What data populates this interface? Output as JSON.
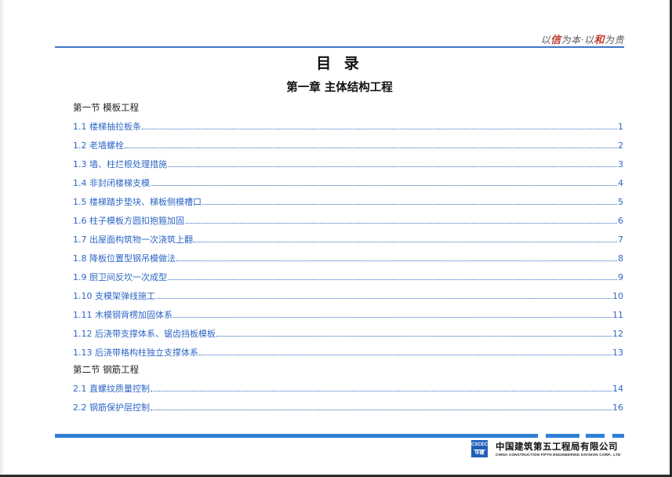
{
  "header": {
    "slogan_a": "以",
    "slogan_b": "信",
    "slogan_c": "为本·以",
    "slogan_d": "和",
    "slogan_e": "为贵"
  },
  "title": "目 录",
  "chapter": "第一章  主体结构工程",
  "sections": [
    {
      "heading": "第一节  模板工程",
      "entries": [
        {
          "text": "1.1 楼梯抽拉板条",
          "page": "1"
        },
        {
          "text": "1.2 老墙螺栓",
          "page": "2"
        },
        {
          "text": "1.3 墙、柱烂根处理措施",
          "page": "3"
        },
        {
          "text": "1.4 非封闭楼梯支模",
          "page": "4"
        },
        {
          "text": "1.5 楼梯踏步垫块、梯板侧模槽口",
          "page": "5"
        },
        {
          "text": "1.6 柱子模板方圆扣抱箍加固",
          "page": "6"
        },
        {
          "text": "1.7 出屋面构筑物一次浇筑上翻",
          "page": "7"
        },
        {
          "text": "1.8 降板位置型钢吊模做法",
          "page": "8"
        },
        {
          "text": "1.9 厨卫间反坎一次成型",
          "page": "9"
        },
        {
          "text": "1.10 支模架弹线施工",
          "page": "10"
        },
        {
          "text": "1.11 木模钢背楞加固体系",
          "page": "11"
        },
        {
          "text": "1.12 后浇带支撑体系、锯齿挡板模板",
          "page": "12"
        },
        {
          "text": "1.13 后浇带格构柱独立支撑体系",
          "page": "13"
        }
      ]
    },
    {
      "heading": "第二节  钢筋工程",
      "entries": [
        {
          "text": "2.1 直螺纹质量控制",
          "page": "14"
        },
        {
          "text": "2.2 钢筋保护层控制",
          "page": "16"
        }
      ]
    }
  ],
  "footer": {
    "logo_top": "CSCEC",
    "logo_bottom": "中建",
    "company_cn": "中国建筑第五工程局有限公司",
    "company_en": "CHINA CONSTRUCTION FIFTH ENGINEERING DIVISION CORP., LTD"
  },
  "colors": {
    "accent": "#2f7fd6",
    "link": "#2f67c6",
    "slogan_red": "#c0392b"
  }
}
